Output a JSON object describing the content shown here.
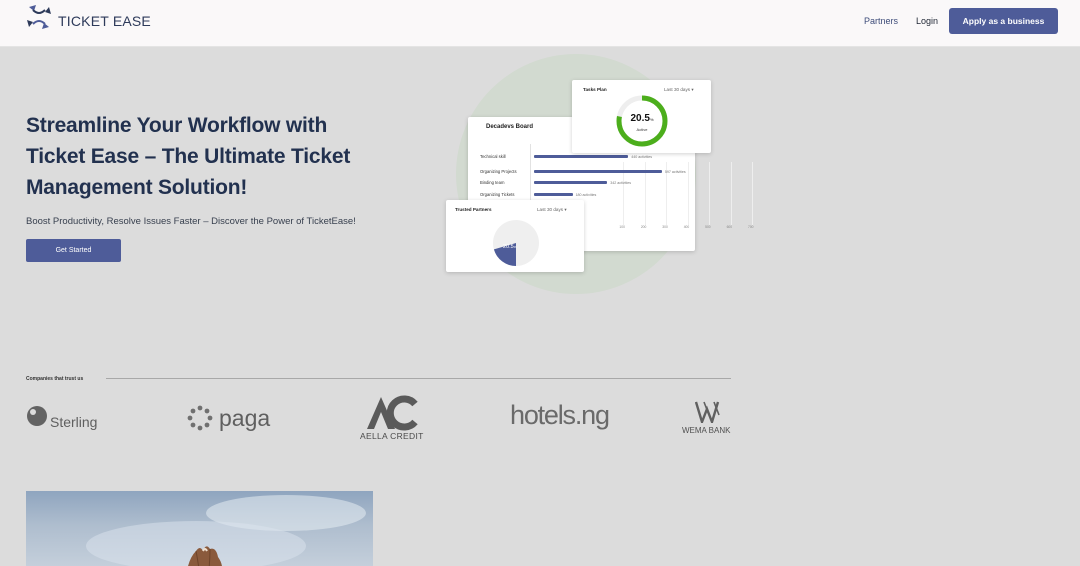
{
  "header": {
    "brand": "TICKET EASE",
    "nav": {
      "partners": "Partners",
      "login": "Login"
    },
    "apply_button": "Apply as a business"
  },
  "hero": {
    "title": "Streamline Your Workflow with Ticket Ease – The Ultimate Ticket Management Solution!",
    "subtitle": "Boost Productivity, Resolve Issues Faster – Discover the Power of TicketEase!",
    "cta": "Get Started"
  },
  "illustration": {
    "board": {
      "title": "Decadevs Board",
      "rows": [
        {
          "label": "Technical skill",
          "value_text": "440 activities",
          "value": 440
        },
        {
          "label": "Organizing Projects",
          "value_text": "597 activities",
          "value": 597
        },
        {
          "label": "Binding team",
          "value_text": "342 activities",
          "value": 342
        },
        {
          "label": "Organizing Tickets",
          "value_text": "180 activities",
          "value": 180
        }
      ],
      "ticks": [
        "100",
        "200",
        "300",
        "400",
        "500",
        "600",
        "700"
      ]
    },
    "tasks_plan": {
      "title": "Tasks Plan",
      "range": "Last 30 days ▾",
      "value": "20.5",
      "unit": "%",
      "label": "Active",
      "ring_fill": 0.78,
      "ring_color": "#4cae1c"
    },
    "trusted_partners": {
      "title": "Trusted Partners",
      "range": "Last 30 days ▾",
      "value": "20.5",
      "unit": "%",
      "slice_fraction": 0.205,
      "slice_color": "#4e5c99"
    }
  },
  "trust": {
    "label": "Companies that trust us",
    "companies": [
      {
        "name": "Sterling",
        "icon": "sterling-dot-icon"
      },
      {
        "name": "paga",
        "icon": "paga-dots-icon"
      },
      {
        "name": "AELLA CREDIT",
        "icon": "aella-ac-icon"
      },
      {
        "name": "hotels.ng",
        "icon": "hotelsng-wordmark"
      },
      {
        "name": "WEMA BANK",
        "icon": "wema-w-icon"
      }
    ]
  },
  "colors": {
    "brand": "#4e5c99",
    "page_bg": "#dcdcdc",
    "header_bg": "#faf8f9",
    "title": "#22314f"
  }
}
